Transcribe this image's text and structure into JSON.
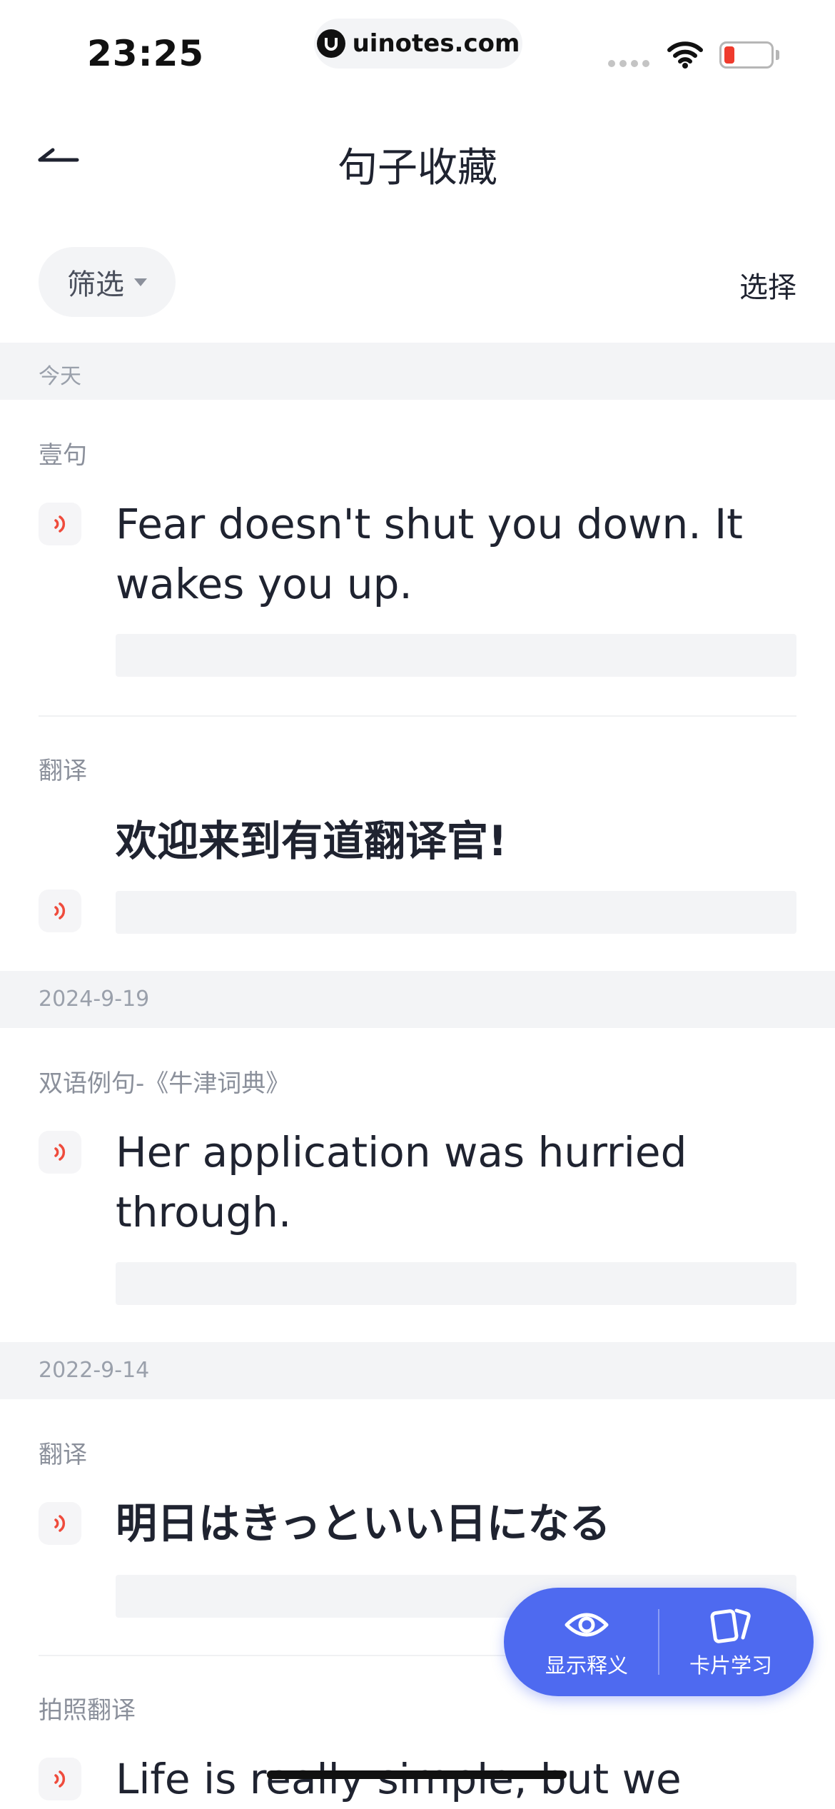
{
  "status_bar": {
    "time": "23:25",
    "url": "uinotes.com"
  },
  "nav": {
    "title": "句子收藏"
  },
  "toolbar": {
    "filter_label": "筛选",
    "select_label": "选择"
  },
  "groups": [
    {
      "date": "今天",
      "items": [
        {
          "category": "壹句",
          "sentence_line1": "Fear doesn't shut you down. It",
          "sentence_line2": "wakes you up."
        },
        {
          "category": "翻译",
          "sentence": "欢迎来到有道翻译官!"
        }
      ]
    },
    {
      "date": "2024-9-19",
      "items": [
        {
          "category": "双语例句-《牛津词典》",
          "sentence_line1": "Her application was hurried",
          "sentence_line2": "through."
        }
      ]
    },
    {
      "date": "2022-9-14",
      "items": [
        {
          "category": "翻译",
          "sentence": "明日はきっといい日になる"
        },
        {
          "category": "拍照翻译",
          "sentence": "Life is really simple, but we"
        }
      ]
    }
  ],
  "fab": {
    "show_meaning_label": "显示释义",
    "card_study_label": "卡片学习"
  },
  "colors": {
    "accent": "#4e6af0",
    "sound_icon": "#ef4b3c",
    "battery_low": "#ef3b2d"
  },
  "icons": [
    "back-arrow-icon",
    "sound-icon",
    "eye-icon",
    "cards-icon",
    "wifi-icon",
    "battery-icon"
  ]
}
